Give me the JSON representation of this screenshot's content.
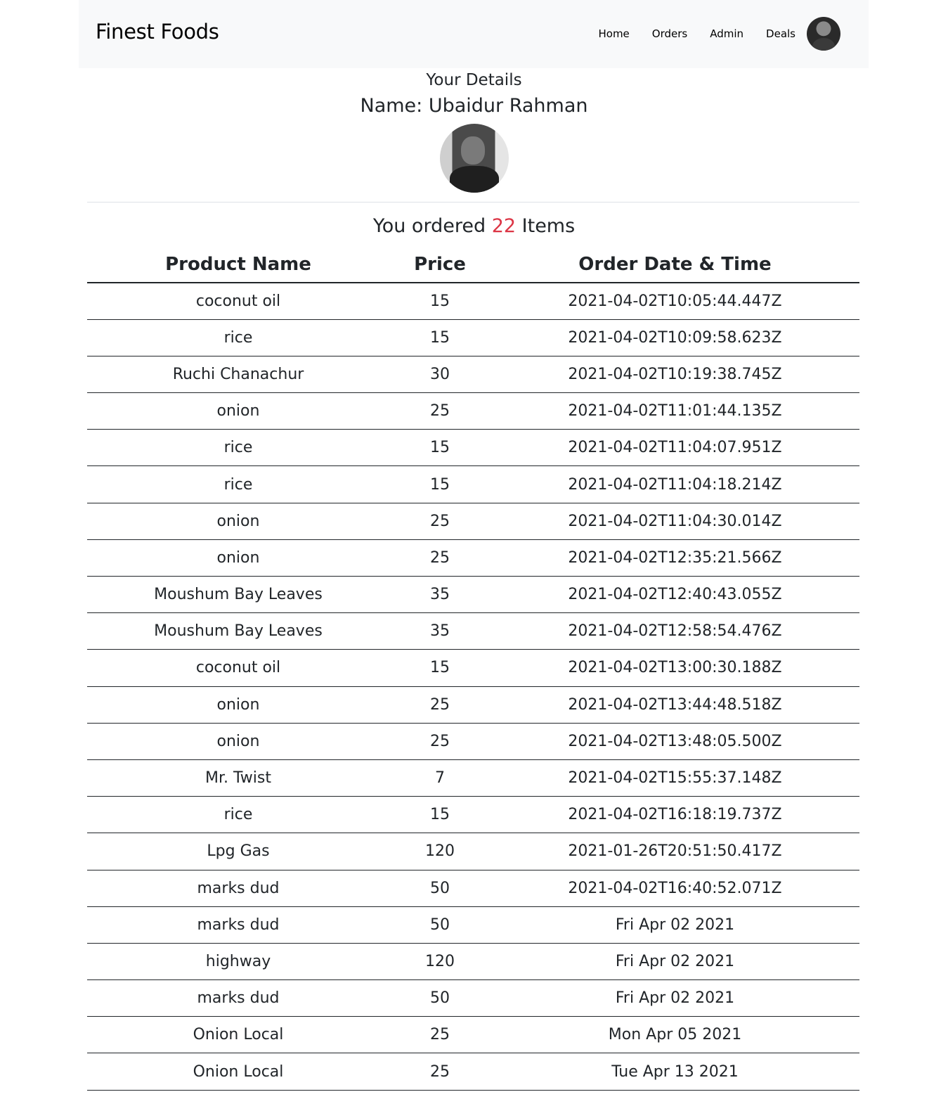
{
  "navbar": {
    "brand": "Finest Foods",
    "links": [
      "Home",
      "Orders",
      "Admin",
      "Deals"
    ]
  },
  "details": {
    "title": "Your Details",
    "name": "Name: Ubaidur Rahman"
  },
  "summary": {
    "prefix": "You ordered",
    "count": "22",
    "suffix": "Items"
  },
  "table": {
    "headers": [
      "Product Name",
      "Price",
      "Order Date & Time"
    ],
    "rows": [
      [
        "coconut oil",
        "15",
        "2021-04-02T10:05:44.447Z"
      ],
      [
        "rice",
        "15",
        "2021-04-02T10:09:58.623Z"
      ],
      [
        "Ruchi Chanachur",
        "30",
        "2021-04-02T10:19:38.745Z"
      ],
      [
        "onion",
        "25",
        "2021-04-02T11:01:44.135Z"
      ],
      [
        "rice",
        "15",
        "2021-04-02T11:04:07.951Z"
      ],
      [
        "rice",
        "15",
        "2021-04-02T11:04:18.214Z"
      ],
      [
        "onion",
        "25",
        "2021-04-02T11:04:30.014Z"
      ],
      [
        "onion",
        "25",
        "2021-04-02T12:35:21.566Z"
      ],
      [
        "Moushum Bay Leaves",
        "35",
        "2021-04-02T12:40:43.055Z"
      ],
      [
        "Moushum Bay Leaves",
        "35",
        "2021-04-02T12:58:54.476Z"
      ],
      [
        "coconut oil",
        "15",
        "2021-04-02T13:00:30.188Z"
      ],
      [
        "onion",
        "25",
        "2021-04-02T13:44:48.518Z"
      ],
      [
        "onion",
        "25",
        "2021-04-02T13:48:05.500Z"
      ],
      [
        "Mr. Twist",
        "7",
        "2021-04-02T15:55:37.148Z"
      ],
      [
        "rice",
        "15",
        "2021-04-02T16:18:19.737Z"
      ],
      [
        "Lpg Gas",
        "120",
        "2021-01-26T20:51:50.417Z"
      ],
      [
        "marks dud",
        "50",
        "2021-04-02T16:40:52.071Z"
      ],
      [
        "marks dud",
        "50",
        "Fri Apr 02 2021"
      ],
      [
        "highway",
        "120",
        "Fri Apr 02 2021"
      ],
      [
        "marks dud",
        "50",
        "Fri Apr 02 2021"
      ],
      [
        "Onion Local",
        "25",
        "Mon Apr 05 2021"
      ],
      [
        "Onion Local",
        "25",
        "Tue Apr 13 2021"
      ]
    ]
  }
}
